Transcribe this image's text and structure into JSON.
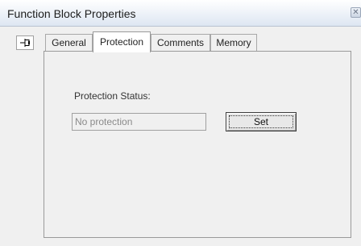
{
  "window": {
    "title": "Function Block Properties"
  },
  "tabs": [
    {
      "label": "General"
    },
    {
      "label": "Protection",
      "active": true
    },
    {
      "label": "Comments"
    },
    {
      "label": "Memory"
    }
  ],
  "protection": {
    "status_label": "Protection Status:",
    "status_value": "No protection",
    "set_label": "Set"
  },
  "icons": {
    "close": "close-icon",
    "pin": "pin-icon"
  }
}
